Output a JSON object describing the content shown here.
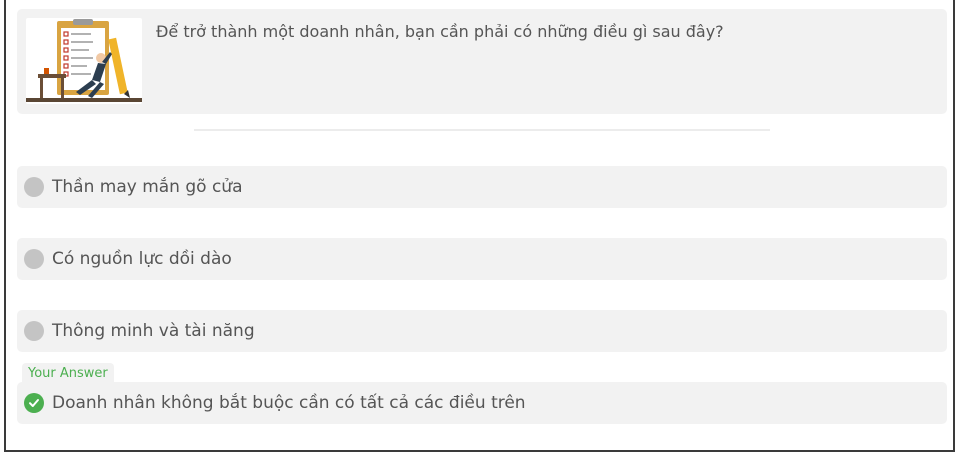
{
  "question": {
    "text": "Để trở thành một doanh nhân, bạn cần phải có những điều gì sau đây?",
    "image_icon": "businessman-checklist-illustration"
  },
  "options": [
    {
      "label": "Thần may mắn gõ cửa",
      "state": "unselected"
    },
    {
      "label": "Có nguồn lực dồi dào",
      "state": "unselected"
    },
    {
      "label": "Thông minh và tài năng",
      "state": "unselected"
    },
    {
      "label": "Doanh nhân không bắt buộc cần có tất cả các điều trên",
      "state": "selected-correct"
    }
  ],
  "your_answer_label": "Your Answer",
  "colors": {
    "card_bg": "#f2f2f2",
    "radio_grey": "#c4c4c4",
    "correct_green": "#4caf50",
    "text": "#555555"
  }
}
